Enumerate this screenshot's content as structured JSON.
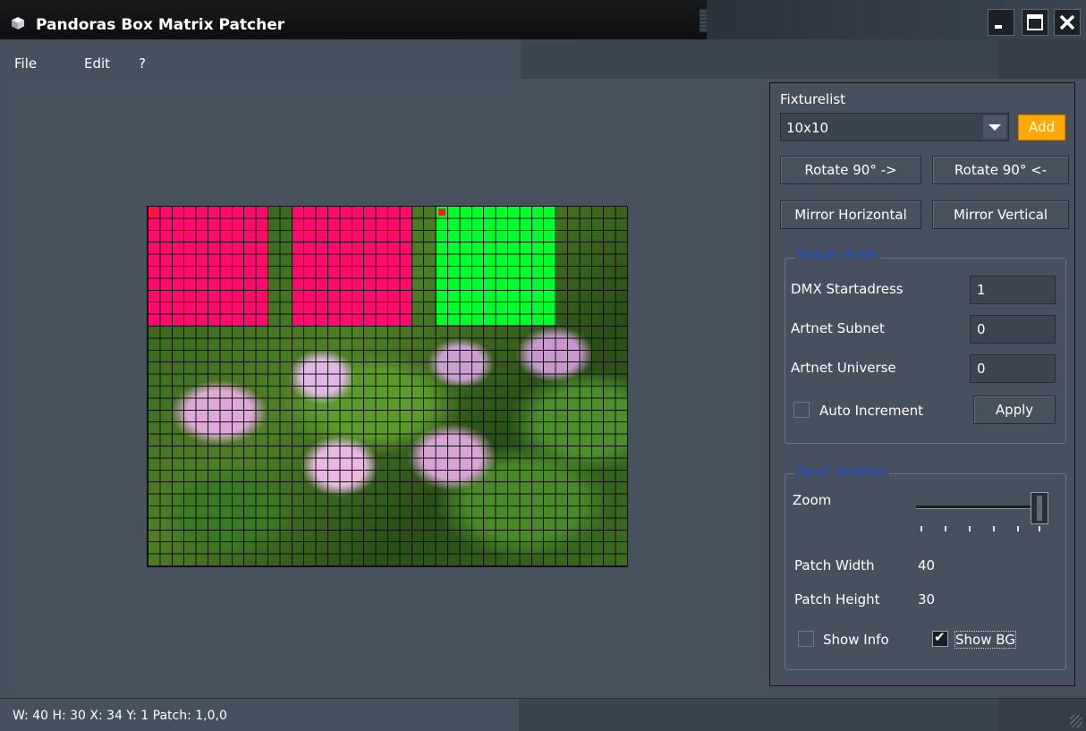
{
  "window": {
    "title": "Pandoras Box Matrix Patcher"
  },
  "menu": {
    "items": [
      "File",
      "Edit",
      "?"
    ]
  },
  "fixture": {
    "label": "Fixturelist",
    "selected": "10x10",
    "add_label": "Add",
    "rotate_cw": "Rotate 90° ->",
    "rotate_ccw": "Rotate 90° <-",
    "mirror_h": "Mirror Horizontal",
    "mirror_v": "Mirror Vertical"
  },
  "fixture_patch": {
    "title": "Fixture Patch",
    "dmx_label": "DMX Startadress",
    "dmx_value": "1",
    "subnet_label": "Artnet Subnet",
    "subnet_value": "0",
    "universe_label": "Artnet Universe",
    "universe_value": "0",
    "auto_increment_label": "Auto Increment",
    "auto_increment_checked": false,
    "apply_label": "Apply"
  },
  "patch_settings": {
    "title": "Patch Settings",
    "zoom_label": "Zoom",
    "zoom_level": 1.0,
    "width_label": "Patch Width",
    "width_value": "40",
    "height_label": "Patch Height",
    "height_value": "30",
    "show_info_label": "Show Info",
    "show_info_checked": false,
    "show_bg_label": "Show BG",
    "show_bg_checked": true
  },
  "status": {
    "text": "W: 40  H: 30  X: 34  Y: 1  Patch: 1,0,0"
  },
  "colors": {
    "fixture_a": "#ff0a6e",
    "fixture_b": "#ff0a6e",
    "fixture_selected": "#00ff2e",
    "add_button": "#ffa900"
  }
}
